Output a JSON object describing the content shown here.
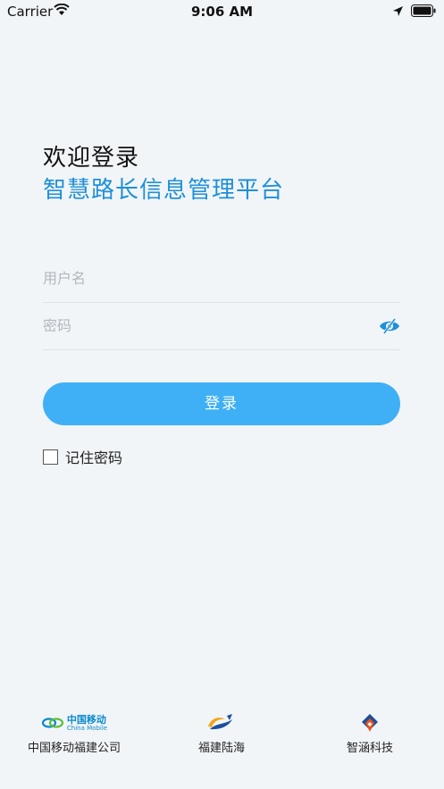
{
  "status_bar": {
    "carrier": "Carrier",
    "time": "9:06 AM"
  },
  "header": {
    "welcome": "欢迎登录",
    "platform_name": "智慧路长信息管理平台"
  },
  "form": {
    "username_placeholder": "用户名",
    "password_placeholder": "密码",
    "login_label": "登录",
    "remember_label": "记住密码"
  },
  "footer": {
    "partners": [
      {
        "name": "中国移动福建公司",
        "logo_text": "中国移动",
        "logo_sub": "China Mobile"
      },
      {
        "name": "福建陆海"
      },
      {
        "name": "智涵科技"
      }
    ]
  },
  "colors": {
    "accent": "#1e90d8",
    "button": "#3fb0f5",
    "background": "#f2f5f8"
  }
}
